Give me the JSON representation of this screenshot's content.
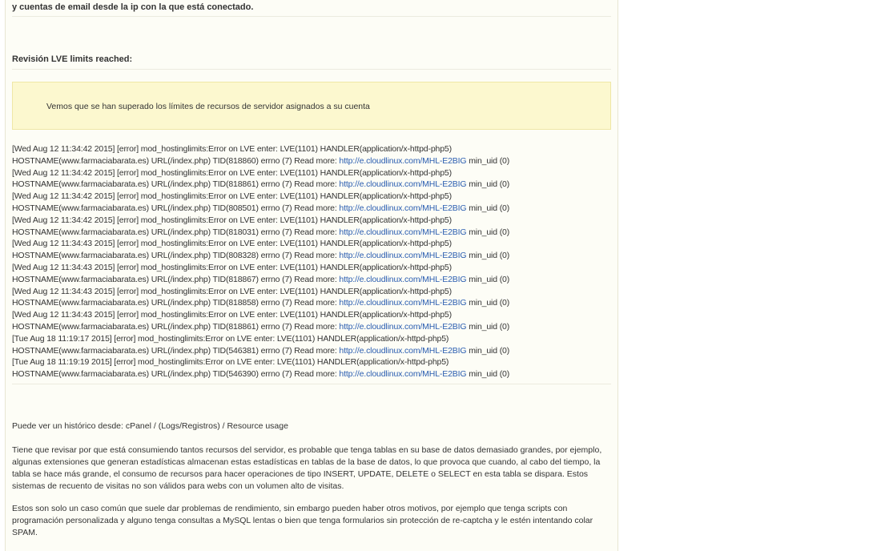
{
  "intro": {
    "tail_text": "y cuentas de email desde la ip con la que está conectado."
  },
  "section": {
    "title": "Revisión LVE limits reached:"
  },
  "alert": {
    "text": "Vemos que se han superado los límites de recursos de servidor asignados a su cuenta"
  },
  "log": {
    "entries": [
      {
        "error": "[Wed Aug 12 11:34:42 2015] [error] mod_hostinglimits:Error on LVE enter: LVE(1101) HANDLER(application/x-httpd-php5)",
        "host": "HOSTNAME(www.farmaciabarata.es) URL(/index.php) TID(818860) errno (7) Read more: ",
        "link": "http://e.cloudlinux.com/MHL-E2BIG",
        "suffix": " min_uid (0)"
      },
      {
        "error": "[Wed Aug 12 11:34:42 2015] [error] mod_hostinglimits:Error on LVE enter: LVE(1101) HANDLER(application/x-httpd-php5)",
        "host": "HOSTNAME(www.farmaciabarata.es) URL(/index.php) TID(818861) errno (7) Read more: ",
        "link": "http://e.cloudlinux.com/MHL-E2BIG",
        "suffix": " min_uid (0)"
      },
      {
        "error": "[Wed Aug 12 11:34:42 2015] [error] mod_hostinglimits:Error on LVE enter: LVE(1101) HANDLER(application/x-httpd-php5)",
        "host": "HOSTNAME(www.farmaciabarata.es) URL(/index.php) TID(808501) errno (7) Read more: ",
        "link": "http://e.cloudlinux.com/MHL-E2BIG",
        "suffix": " min_uid (0)"
      },
      {
        "error": "[Wed Aug 12 11:34:42 2015] [error] mod_hostinglimits:Error on LVE enter: LVE(1101) HANDLER(application/x-httpd-php5)",
        "host": "HOSTNAME(www.farmaciabarata.es) URL(/index.php) TID(818031) errno (7) Read more: ",
        "link": "http://e.cloudlinux.com/MHL-E2BIG",
        "suffix": " min_uid (0)"
      },
      {
        "error": "[Wed Aug 12 11:34:43 2015] [error] mod_hostinglimits:Error on LVE enter: LVE(1101) HANDLER(application/x-httpd-php5)",
        "host": "HOSTNAME(www.farmaciabarata.es) URL(/index.php) TID(808328) errno (7) Read more: ",
        "link": "http://e.cloudlinux.com/MHL-E2BIG",
        "suffix": " min_uid (0)"
      },
      {
        "error": "[Wed Aug 12 11:34:43 2015] [error] mod_hostinglimits:Error on LVE enter: LVE(1101) HANDLER(application/x-httpd-php5)",
        "host": "HOSTNAME(www.farmaciabarata.es) URL(/index.php) TID(818867) errno (7) Read more: ",
        "link": "http://e.cloudlinux.com/MHL-E2BIG",
        "suffix": " min_uid (0)"
      },
      {
        "error": "[Wed Aug 12 11:34:43 2015] [error] mod_hostinglimits:Error on LVE enter: LVE(1101) HANDLER(application/x-httpd-php5)",
        "host": "HOSTNAME(www.farmaciabarata.es) URL(/index.php) TID(818858) errno (7) Read more: ",
        "link": "http://e.cloudlinux.com/MHL-E2BIG",
        "suffix": " min_uid (0)"
      },
      {
        "error": "[Wed Aug 12 11:34:43 2015] [error] mod_hostinglimits:Error on LVE enter: LVE(1101) HANDLER(application/x-httpd-php5)",
        "host": "HOSTNAME(www.farmaciabarata.es) URL(/index.php) TID(818861) errno (7) Read more: ",
        "link": "http://e.cloudlinux.com/MHL-E2BIG",
        "suffix": " min_uid (0)"
      },
      {
        "error": "[Tue Aug 18 11:19:17 2015] [error] mod_hostinglimits:Error on LVE enter: LVE(1101) HANDLER(application/x-httpd-php5)",
        "host": "HOSTNAME(www.farmaciabarata.es) URL(/index.php) TID(546381) errno (7) Read more: ",
        "link": "http://e.cloudlinux.com/MHL-E2BIG",
        "suffix": " min_uid (0)"
      },
      {
        "error": "[Tue Aug 18 11:19:19 2015] [error] mod_hostinglimits:Error on LVE enter: LVE(1101) HANDLER(application/x-httpd-php5)",
        "host": "HOSTNAME(www.farmaciabarata.es) URL(/index.php) TID(546390) errno (7) Read more: ",
        "link": "http://e.cloudlinux.com/MHL-E2BIG",
        "suffix": " min_uid (0)"
      }
    ]
  },
  "body": {
    "history_text": "Puede ver un histórico desde: cPanel / (Logs/Registros) / Resource usage",
    "paragraph_1": "Tiene que revisar por que está consumiendo tantos recursos del servidor, es probable que tenga tablas en su base de datos demasiado grandes, por ejemplo, algunas extensiones que generan estadísticas almacenan estas estadísticas en tablas de la base de datos, lo que provoca que cuando, al cabo del tiempo, la tabla se hace más grande, el consumo de recursos para hacer operaciones de tipo INSERT, UPDATE, DELETE o SELECT en esta tabla se dispara. Estos sistemas de recuento de visitas no son válidos para webs con un volumen alto de visitas.",
    "paragraph_2": "Estos son solo un caso común que suele dar problemas de rendimiento, sin embargo pueden haber otros motivos, por ejemplo que tenga scripts con programación personalizada y alguno tenga consultas a MySQL lentas o bien que tenga formularios sin protección de re-captcha y le estén intentando colar SPAM."
  },
  "colors": {
    "panel_background": "#fdfdf6",
    "alert_background": "#fcf8cf",
    "link": "#2a5db0"
  }
}
